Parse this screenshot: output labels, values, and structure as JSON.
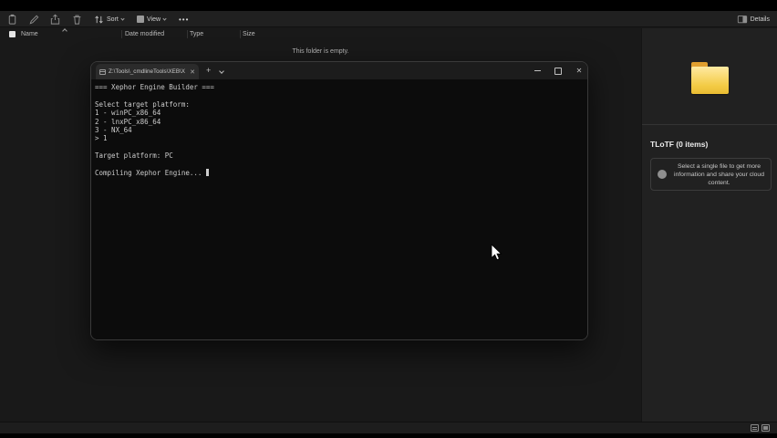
{
  "toolbar": {
    "sort_label": "Sort",
    "view_label": "View",
    "more_label": "•••",
    "details_label": "Details"
  },
  "columns": {
    "name": "Name",
    "date_modified": "Date modified",
    "type": "Type",
    "size": "Size"
  },
  "content": {
    "empty_message": "This folder is empty."
  },
  "details_panel": {
    "title": "TLoTF (0 items)",
    "hint": "Select a single file to get more information and share your cloud content."
  },
  "terminal": {
    "tab_title": "Z:\\Tools\\_cmdlineTools\\XEB\\X",
    "tab_close_glyph": "✕",
    "new_tab_label": "+",
    "close_glyph": "✕",
    "lines": [
      "=== Xephor Engine Builder ===",
      "",
      "Select target platform:",
      "1 - winPC_x86_64",
      "2 - lnxPC_x86_64",
      "3 - NX_64",
      "> 1",
      "",
      "Target platform: PC",
      "",
      "Compiling Xephor Engine... "
    ]
  },
  "colors": {
    "folder_accent": "#f3cb45",
    "terminal_bg": "#0c0c0c",
    "app_bg": "#191919"
  }
}
